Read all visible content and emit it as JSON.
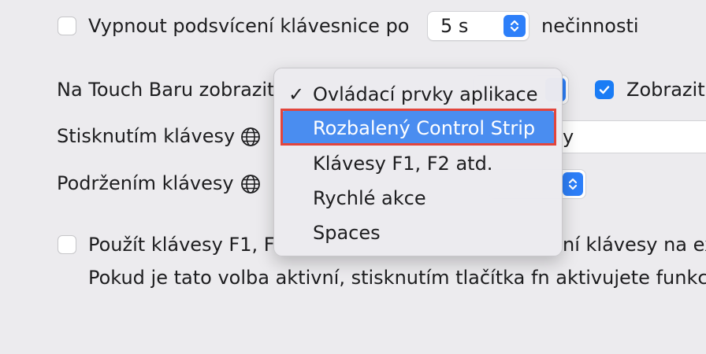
{
  "backlight": {
    "label_before": "Vypnout podsvícení klávesnice po",
    "value": "5 s",
    "label_after": "nečinnosti",
    "checked": false
  },
  "touchbar": {
    "label": "Na Touch Baru zobrazit",
    "show_checkbox_label": "Zobrazit",
    "show_checked": true
  },
  "press_key": {
    "label": "Stisknutím klávesy",
    "partial_value": "y"
  },
  "hold_key": {
    "label": "Podržením klávesy"
  },
  "fn_keys": {
    "label_start": "Použít klávesy F1, F",
    "label_end": "ní klávesy na ex",
    "description": "Pokud je tato volba aktivní, stisknutím tlačítka fn aktivujete funkco",
    "checked": false
  },
  "menu": {
    "items": [
      {
        "label": "Ovládací prvky aplikace",
        "checked": true
      },
      {
        "label": "Rozbalený Control Strip",
        "highlighted": true
      },
      {
        "label": "Klávesy F1, F2 atd."
      },
      {
        "label": "Rychlé akce"
      },
      {
        "label": "Spaces"
      }
    ],
    "check_glyph": "✓"
  },
  "colors": {
    "accent": "#2d7ff9",
    "menu_highlight": "#4a8df0",
    "annotation_red": "#e2453c"
  }
}
